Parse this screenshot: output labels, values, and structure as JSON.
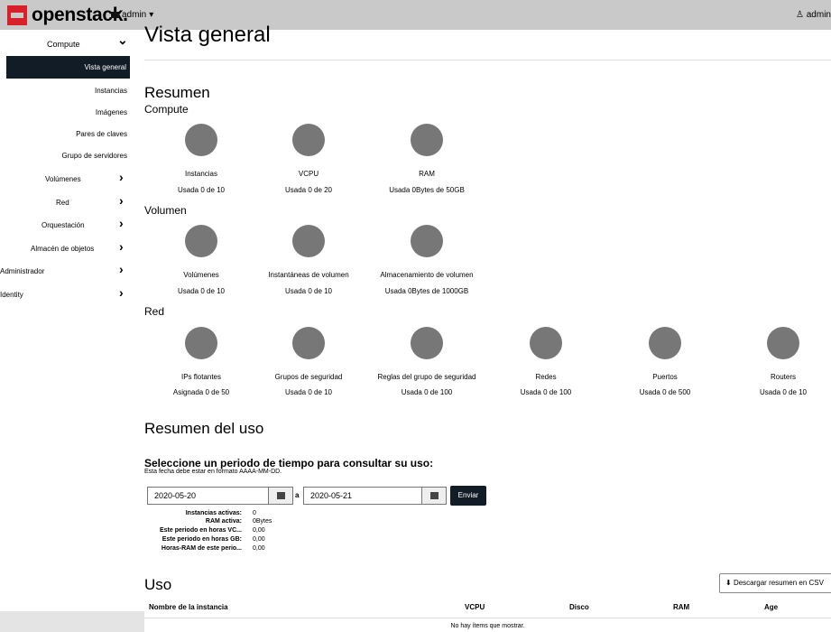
{
  "brand": "openstack.",
  "header": {
    "project": "admin",
    "project_caret": "▾",
    "user": "admin"
  },
  "sidebar": {
    "items": [
      {
        "label": "Compute",
        "chevron": "⌄"
      },
      {
        "label": "Vista general"
      },
      {
        "label": "Instancias"
      },
      {
        "label": "Imágenes"
      },
      {
        "label": "Pares de claves"
      },
      {
        "label": "Grupo de servidores"
      },
      {
        "label": "Volúmenes",
        "chevron": "›"
      },
      {
        "label": "Red",
        "chevron": "›"
      },
      {
        "label": "Orquestación",
        "chevron": "›"
      },
      {
        "label": "Almacén de objetos",
        "chevron": "›"
      },
      {
        "label": "Administrador",
        "chevron": "›"
      },
      {
        "label": "Identity",
        "chevron": "›"
      }
    ]
  },
  "page": {
    "title": "Vista general"
  },
  "summary": {
    "title": "Resumen",
    "groups": [
      {
        "title": "Compute",
        "items": [
          {
            "label": "Instancias",
            "usage": "Usada 0 de 10"
          },
          {
            "label": "VCPU",
            "usage": "Usada 0 de 20"
          },
          {
            "label": "RAM",
            "usage": "Usada 0Bytes de 50GB"
          }
        ]
      },
      {
        "title": "Volumen",
        "items": [
          {
            "label": "Volúmenes",
            "usage": "Usada 0 de 10"
          },
          {
            "label": "Instantáneas de volumen",
            "usage": "Usada 0 de 10"
          },
          {
            "label": "Almacenamiento de volumen",
            "usage": "Usada 0Bytes de 1000GB"
          }
        ]
      },
      {
        "title": "Red",
        "items": [
          {
            "label": "IPs flotantes",
            "usage": "Asignada 0 de 50"
          },
          {
            "label": "Grupos de seguridad",
            "usage": "Usada 0 de 10"
          },
          {
            "label": "Reglas del grupo de seguridad",
            "usage": "Usada 0 de 100"
          },
          {
            "label": "Redes",
            "usage": "Usada 0 de 100"
          },
          {
            "label": "Puertos",
            "usage": "Usada 0 de 500"
          },
          {
            "label": "Routers",
            "usage": "Usada 0 de 10"
          }
        ]
      }
    ]
  },
  "usage_summary": {
    "title": "Resumen del uso",
    "period_title": "Seleccione un periodo de tiempo para consultar su uso:",
    "hint": "Esta fecha debe estar en formato AAAA-MM-DD.",
    "from": "2020-05-20",
    "sep": "a",
    "to": "2020-05-21",
    "submit": "Enviar",
    "stats": [
      {
        "k": "Instancias activas:",
        "v": "0"
      },
      {
        "k": "RAM activa:",
        "v": "0Bytes"
      },
      {
        "k": "Este periodo en horas VC...",
        "v": "0,00"
      },
      {
        "k": "Este periodo en horas GB:",
        "v": "0,00"
      },
      {
        "k": "Horas-RAM de este perio...",
        "v": "0,00"
      }
    ]
  },
  "usage": {
    "title": "Uso",
    "csv_label": "Descargar resumen en CSV",
    "columns": [
      "Nombre de la instancia",
      "VCPU",
      "Disco",
      "RAM",
      "Age"
    ],
    "empty": "No hay ítems que mostrar."
  }
}
